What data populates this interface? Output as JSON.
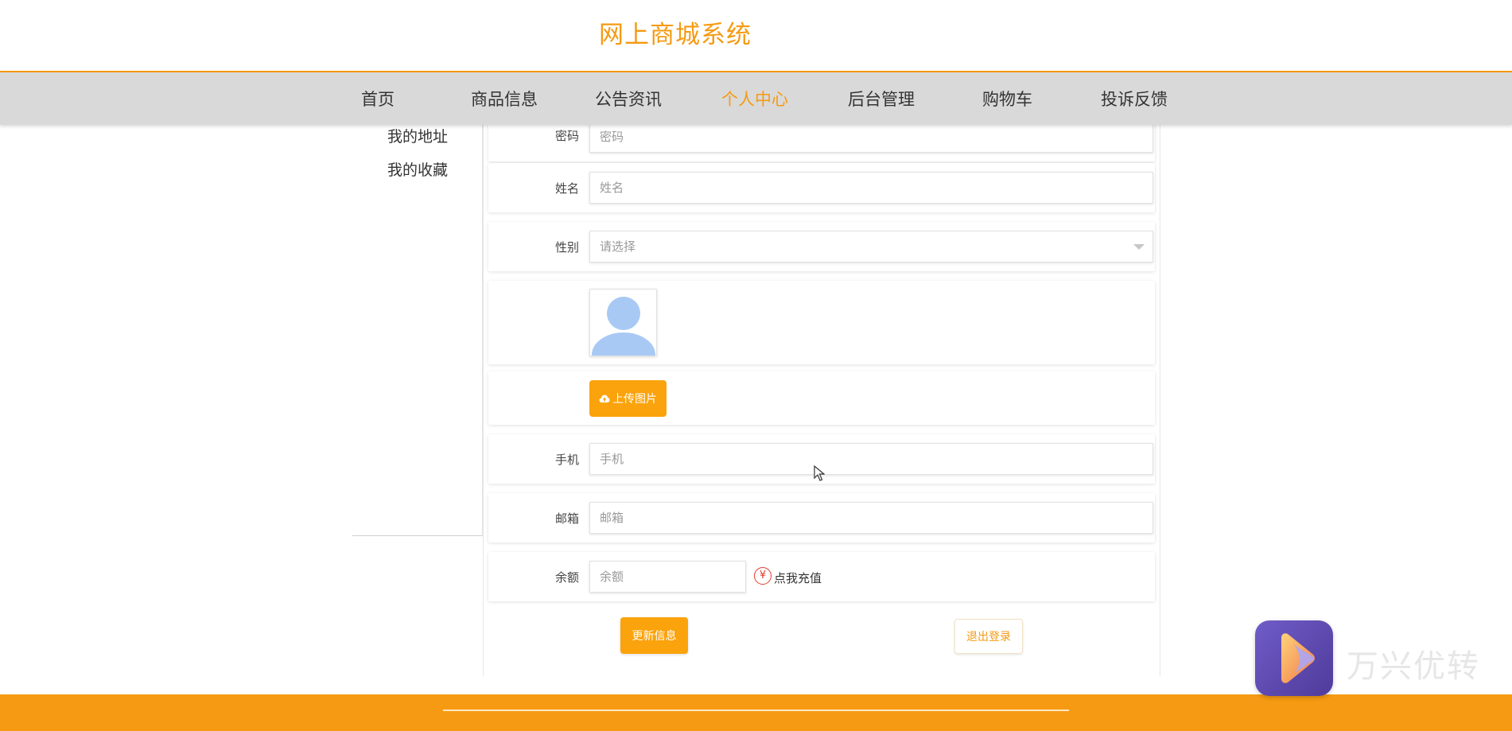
{
  "header": {
    "site_title": "网上商城系统"
  },
  "nav": {
    "items": [
      {
        "label": "首页"
      },
      {
        "label": "商品信息"
      },
      {
        "label": "公告资讯"
      },
      {
        "label": "个人中心"
      },
      {
        "label": "后台管理"
      },
      {
        "label": "购物车"
      },
      {
        "label": "投诉反馈"
      }
    ],
    "active": "个人中心"
  },
  "sidebar": {
    "items": [
      {
        "label": "我的地址"
      },
      {
        "label": "我的收藏"
      }
    ]
  },
  "form": {
    "password": {
      "label": "密码",
      "placeholder": "密码"
    },
    "name": {
      "label": "姓名",
      "placeholder": "姓名"
    },
    "gender": {
      "label": "性别",
      "placeholder": "请选择"
    },
    "upload_label": "上传图片",
    "phone": {
      "label": "手机",
      "placeholder": "手机"
    },
    "email": {
      "label": "邮箱",
      "placeholder": "邮箱"
    },
    "balance": {
      "label": "余额",
      "placeholder": "余额"
    },
    "recharge_icon": "¥",
    "recharge_label": "点我充值",
    "update_label": "更新信息",
    "logout_label": "退出登录"
  },
  "watermark": {
    "text": "万兴优转"
  },
  "colors": {
    "accent": "#f59a12",
    "button": "#fba30c",
    "nav_bg": "#d9d9d9",
    "recharge": "#e23b2a"
  }
}
